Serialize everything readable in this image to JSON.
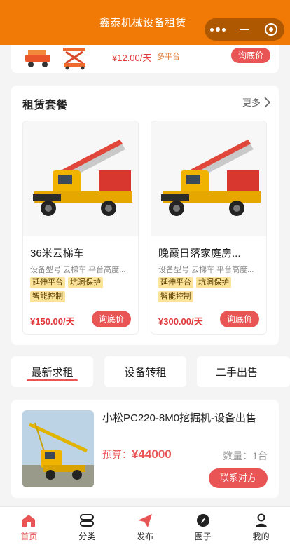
{
  "header": {
    "title": "鑫泰机械设备租赁"
  },
  "strip": {
    "price": "¥12.00/天",
    "tag": "多平台",
    "button": "询底价"
  },
  "section": {
    "title": "租赁套餐",
    "more": "更多",
    "cards": [
      {
        "name": "36米云梯车",
        "spec": "设备型号 云梯车 平台高度...",
        "tags": [
          "延伸平台",
          "坑洞保护",
          "智能控制"
        ],
        "price": "¥150.00/天",
        "button": "询底价"
      },
      {
        "name": "晚霞日落家庭房...",
        "spec": "设备型号 云梯车 平台高度...",
        "tags": [
          "延伸平台",
          "坑洞保护",
          "智能控制"
        ],
        "price": "¥300.00/天",
        "button": "询底价"
      }
    ]
  },
  "tabs": [
    "最新求租",
    "设备转租",
    "二手出售"
  ],
  "listing": {
    "title": "小松PC220-8M0挖掘机-设备出售",
    "budget_label": "预算：",
    "budget_value": "¥44000",
    "qty": "数量：1台",
    "button": "联系对方"
  },
  "nav": [
    {
      "label": "首页",
      "icon": "home-icon"
    },
    {
      "label": "分类",
      "icon": "category-icon"
    },
    {
      "label": "发布",
      "icon": "send-icon"
    },
    {
      "label": "圈子",
      "icon": "compass-icon"
    },
    {
      "label": "我的",
      "icon": "user-icon"
    }
  ],
  "colors": {
    "brand": "#f07a05",
    "accent": "#e95455",
    "tag": "#fbe39a"
  }
}
